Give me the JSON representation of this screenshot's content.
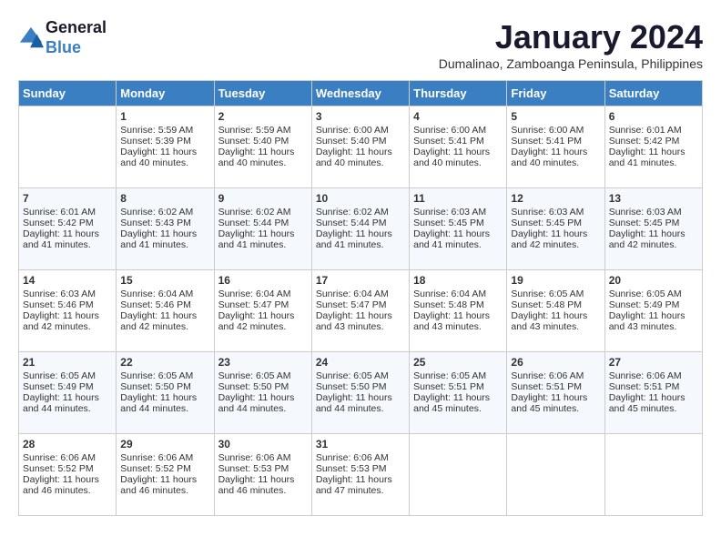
{
  "header": {
    "logo_line1": "General",
    "logo_line2": "Blue",
    "month_title": "January 2024",
    "subtitle": "Dumalinao, Zamboanga Peninsula, Philippines"
  },
  "weekdays": [
    "Sunday",
    "Monday",
    "Tuesday",
    "Wednesday",
    "Thursday",
    "Friday",
    "Saturday"
  ],
  "weeks": [
    [
      {
        "day": "",
        "sunrise": "",
        "sunset": "",
        "daylight": ""
      },
      {
        "day": "1",
        "sunrise": "Sunrise: 5:59 AM",
        "sunset": "Sunset: 5:39 PM",
        "daylight": "Daylight: 11 hours and 40 minutes."
      },
      {
        "day": "2",
        "sunrise": "Sunrise: 5:59 AM",
        "sunset": "Sunset: 5:40 PM",
        "daylight": "Daylight: 11 hours and 40 minutes."
      },
      {
        "day": "3",
        "sunrise": "Sunrise: 6:00 AM",
        "sunset": "Sunset: 5:40 PM",
        "daylight": "Daylight: 11 hours and 40 minutes."
      },
      {
        "day": "4",
        "sunrise": "Sunrise: 6:00 AM",
        "sunset": "Sunset: 5:41 PM",
        "daylight": "Daylight: 11 hours and 40 minutes."
      },
      {
        "day": "5",
        "sunrise": "Sunrise: 6:00 AM",
        "sunset": "Sunset: 5:41 PM",
        "daylight": "Daylight: 11 hours and 40 minutes."
      },
      {
        "day": "6",
        "sunrise": "Sunrise: 6:01 AM",
        "sunset": "Sunset: 5:42 PM",
        "daylight": "Daylight: 11 hours and 41 minutes."
      }
    ],
    [
      {
        "day": "7",
        "sunrise": "Sunrise: 6:01 AM",
        "sunset": "Sunset: 5:42 PM",
        "daylight": "Daylight: 11 hours and 41 minutes."
      },
      {
        "day": "8",
        "sunrise": "Sunrise: 6:02 AM",
        "sunset": "Sunset: 5:43 PM",
        "daylight": "Daylight: 11 hours and 41 minutes."
      },
      {
        "day": "9",
        "sunrise": "Sunrise: 6:02 AM",
        "sunset": "Sunset: 5:44 PM",
        "daylight": "Daylight: 11 hours and 41 minutes."
      },
      {
        "day": "10",
        "sunrise": "Sunrise: 6:02 AM",
        "sunset": "Sunset: 5:44 PM",
        "daylight": "Daylight: 11 hours and 41 minutes."
      },
      {
        "day": "11",
        "sunrise": "Sunrise: 6:03 AM",
        "sunset": "Sunset: 5:45 PM",
        "daylight": "Daylight: 11 hours and 41 minutes."
      },
      {
        "day": "12",
        "sunrise": "Sunrise: 6:03 AM",
        "sunset": "Sunset: 5:45 PM",
        "daylight": "Daylight: 11 hours and 42 minutes."
      },
      {
        "day": "13",
        "sunrise": "Sunrise: 6:03 AM",
        "sunset": "Sunset: 5:45 PM",
        "daylight": "Daylight: 11 hours and 42 minutes."
      }
    ],
    [
      {
        "day": "14",
        "sunrise": "Sunrise: 6:03 AM",
        "sunset": "Sunset: 5:46 PM",
        "daylight": "Daylight: 11 hours and 42 minutes."
      },
      {
        "day": "15",
        "sunrise": "Sunrise: 6:04 AM",
        "sunset": "Sunset: 5:46 PM",
        "daylight": "Daylight: 11 hours and 42 minutes."
      },
      {
        "day": "16",
        "sunrise": "Sunrise: 6:04 AM",
        "sunset": "Sunset: 5:47 PM",
        "daylight": "Daylight: 11 hours and 42 minutes."
      },
      {
        "day": "17",
        "sunrise": "Sunrise: 6:04 AM",
        "sunset": "Sunset: 5:47 PM",
        "daylight": "Daylight: 11 hours and 43 minutes."
      },
      {
        "day": "18",
        "sunrise": "Sunrise: 6:04 AM",
        "sunset": "Sunset: 5:48 PM",
        "daylight": "Daylight: 11 hours and 43 minutes."
      },
      {
        "day": "19",
        "sunrise": "Sunrise: 6:05 AM",
        "sunset": "Sunset: 5:48 PM",
        "daylight": "Daylight: 11 hours and 43 minutes."
      },
      {
        "day": "20",
        "sunrise": "Sunrise: 6:05 AM",
        "sunset": "Sunset: 5:49 PM",
        "daylight": "Daylight: 11 hours and 43 minutes."
      }
    ],
    [
      {
        "day": "21",
        "sunrise": "Sunrise: 6:05 AM",
        "sunset": "Sunset: 5:49 PM",
        "daylight": "Daylight: 11 hours and 44 minutes."
      },
      {
        "day": "22",
        "sunrise": "Sunrise: 6:05 AM",
        "sunset": "Sunset: 5:50 PM",
        "daylight": "Daylight: 11 hours and 44 minutes."
      },
      {
        "day": "23",
        "sunrise": "Sunrise: 6:05 AM",
        "sunset": "Sunset: 5:50 PM",
        "daylight": "Daylight: 11 hours and 44 minutes."
      },
      {
        "day": "24",
        "sunrise": "Sunrise: 6:05 AM",
        "sunset": "Sunset: 5:50 PM",
        "daylight": "Daylight: 11 hours and 44 minutes."
      },
      {
        "day": "25",
        "sunrise": "Sunrise: 6:05 AM",
        "sunset": "Sunset: 5:51 PM",
        "daylight": "Daylight: 11 hours and 45 minutes."
      },
      {
        "day": "26",
        "sunrise": "Sunrise: 6:06 AM",
        "sunset": "Sunset: 5:51 PM",
        "daylight": "Daylight: 11 hours and 45 minutes."
      },
      {
        "day": "27",
        "sunrise": "Sunrise: 6:06 AM",
        "sunset": "Sunset: 5:51 PM",
        "daylight": "Daylight: 11 hours and 45 minutes."
      }
    ],
    [
      {
        "day": "28",
        "sunrise": "Sunrise: 6:06 AM",
        "sunset": "Sunset: 5:52 PM",
        "daylight": "Daylight: 11 hours and 46 minutes."
      },
      {
        "day": "29",
        "sunrise": "Sunrise: 6:06 AM",
        "sunset": "Sunset: 5:52 PM",
        "daylight": "Daylight: 11 hours and 46 minutes."
      },
      {
        "day": "30",
        "sunrise": "Sunrise: 6:06 AM",
        "sunset": "Sunset: 5:53 PM",
        "daylight": "Daylight: 11 hours and 46 minutes."
      },
      {
        "day": "31",
        "sunrise": "Sunrise: 6:06 AM",
        "sunset": "Sunset: 5:53 PM",
        "daylight": "Daylight: 11 hours and 47 minutes."
      },
      {
        "day": "",
        "sunrise": "",
        "sunset": "",
        "daylight": ""
      },
      {
        "day": "",
        "sunrise": "",
        "sunset": "",
        "daylight": ""
      },
      {
        "day": "",
        "sunrise": "",
        "sunset": "",
        "daylight": ""
      }
    ]
  ]
}
